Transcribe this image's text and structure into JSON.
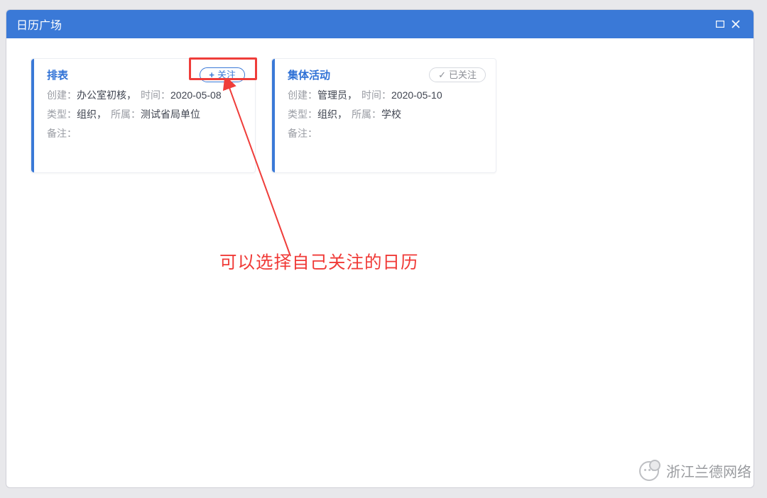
{
  "dialog": {
    "title": "日历广场"
  },
  "cards": [
    {
      "title": "排表",
      "follow_state": "not_followed",
      "follow_label": "关注",
      "already_label": "已关注",
      "creator_label": "创建：",
      "creator_value": "办公室初核，",
      "time_label": "时间：",
      "time_value": "2020-05-08",
      "type_label": "类型：",
      "type_value": "组织，",
      "belong_label": "所属：",
      "belong_value": "测试省局单位",
      "remark_label": "备注：",
      "remark_value": ""
    },
    {
      "title": "集体活动",
      "follow_state": "followed",
      "follow_label": "关注",
      "already_label": "已关注",
      "creator_label": "创建：",
      "creator_value": "管理员，",
      "time_label": "时间：",
      "time_value": "2020-05-10",
      "type_label": "类型：",
      "type_value": "组织，",
      "belong_label": "所属：",
      "belong_value": "学校",
      "remark_label": "备注：",
      "remark_value": ""
    }
  ],
  "annotation": {
    "text": "可以选择自己关注的日历"
  },
  "watermark": {
    "text": "浙江兰德网络"
  }
}
